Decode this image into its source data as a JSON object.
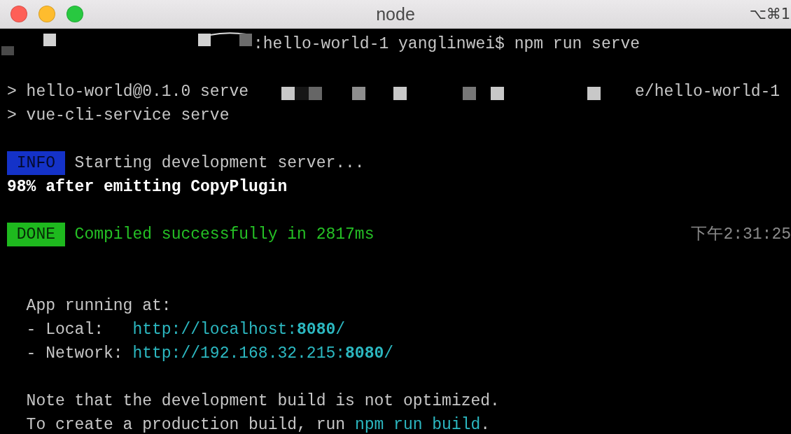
{
  "window": {
    "title": "node",
    "shortcut": "⌥⌘1"
  },
  "terminal": {
    "lines": [
      {
        "kind": "output",
        "indent": false,
        "segments": [
          {
            "kind": "redacted"
          },
          {
            "kind": "plain",
            "text": ":hello-world-1 yanglinwei$ npm run serve"
          }
        ]
      },
      {
        "kind": "blank"
      },
      {
        "kind": "output",
        "indent": false,
        "segments": [
          {
            "kind": "plain",
            "text": "> hello-world@0.1.0 serve"
          },
          {
            "kind": "redacted"
          },
          {
            "kind": "plain",
            "text": "e/hello-world-1"
          }
        ]
      },
      {
        "kind": "output",
        "indent": false,
        "segments": [
          {
            "kind": "plain",
            "text": "> vue-cli-service serve"
          }
        ]
      },
      {
        "kind": "blank"
      },
      {
        "kind": "output",
        "indent": false,
        "segments": [
          {
            "kind": "badge",
            "text": "INFO",
            "color": "#1432c8"
          },
          {
            "kind": "plain",
            "text": "Starting development server..."
          }
        ]
      },
      {
        "kind": "output",
        "indent": false,
        "segments": [
          {
            "kind": "bold",
            "text": "98% after emitting CopyPlugin"
          }
        ]
      },
      {
        "kind": "blank"
      },
      {
        "kind": "output",
        "indent": false,
        "segments": [
          {
            "kind": "badge",
            "text": "DONE",
            "color": "#1eb91e"
          },
          {
            "kind": "success",
            "text": "Compiled successfully in 2817ms"
          }
        ],
        "right": "下午2:31:25"
      },
      {
        "kind": "blank"
      },
      {
        "kind": "blank"
      },
      {
        "kind": "output",
        "indent": true,
        "segments": [
          {
            "kind": "plain",
            "text": "App running at:"
          }
        ]
      },
      {
        "kind": "output",
        "indent": true,
        "segments": [
          {
            "kind": "label",
            "text": "- Local:"
          },
          {
            "kind": "link",
            "text": "http://localhost:**8080**/"
          }
        ]
      },
      {
        "kind": "output",
        "indent": true,
        "segments": [
          {
            "kind": "label",
            "text": "- Network:"
          },
          {
            "kind": "link",
            "text": "http://192.168.32.215:**8080**/"
          }
        ]
      },
      {
        "kind": "blank"
      },
      {
        "kind": "output",
        "indent": true,
        "segments": [
          {
            "kind": "plain",
            "text": "Note that the development build is not optimized."
          }
        ]
      },
      {
        "kind": "output",
        "indent": true,
        "segments": [
          {
            "kind": "plain",
            "text": "To create a production build, run "
          },
          {
            "kind": "command",
            "text": "npm run build"
          },
          {
            "kind": "plain",
            "text": "."
          }
        ]
      }
    ]
  }
}
